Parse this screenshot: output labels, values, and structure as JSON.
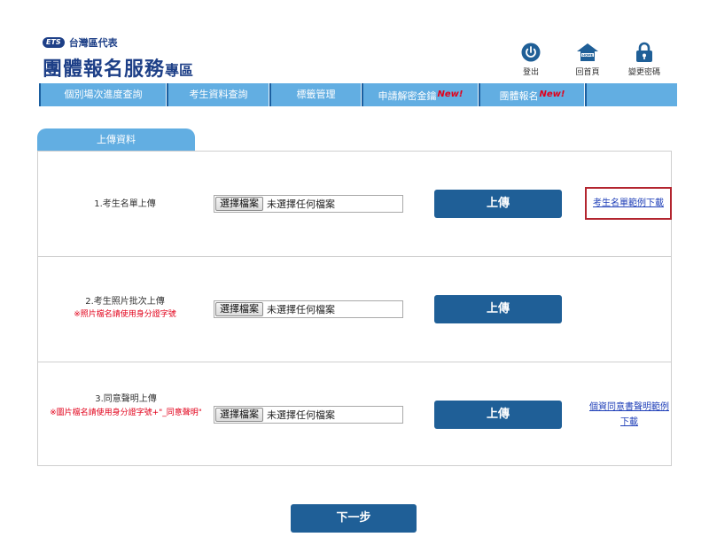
{
  "header": {
    "ets_badge": "ETS",
    "org_name": "台灣區代表",
    "title_main": "團體報名服務",
    "title_sub": "專區",
    "icons": [
      {
        "icon": "power-icon",
        "label": "登出"
      },
      {
        "icon": "home-icon",
        "label": "回首頁",
        "icon_text": "HOME"
      },
      {
        "icon": "lock-icon",
        "label": "變更密碼"
      }
    ]
  },
  "nav": {
    "items": [
      {
        "label": "個別場次進度查詢",
        "new": ""
      },
      {
        "label": "考生資料查詢",
        "new": ""
      },
      {
        "label": "標籤管理",
        "new": ""
      },
      {
        "label": "申請解密金鑰",
        "new": "New!"
      },
      {
        "label": "團體報名",
        "new": "New!"
      }
    ]
  },
  "tab": {
    "label": "上傳資料"
  },
  "rows": [
    {
      "label": "1.考生名單上傳",
      "note": "",
      "file_button": "選擇檔案",
      "file_status": "未選擇任何檔案",
      "upload_label": "上傳",
      "link": "考生名單範例下載"
    },
    {
      "label": "2.考生照片批次上傳",
      "note": "※照片檔名請使用身分證字號",
      "file_button": "選擇檔案",
      "file_status": "未選擇任何檔案",
      "upload_label": "上傳",
      "link": ""
    },
    {
      "label": "3.同意聲明上傳",
      "note": "※圖片檔名請使用身分證字號+\"_同意聲明\"",
      "file_button": "選擇檔案",
      "file_status": "未選擇任何檔案",
      "upload_label": "上傳",
      "link": "個資同意書聲明範例下載"
    }
  ],
  "next_button": "下一步",
  "colors": {
    "nav_bg": "#62aee2",
    "button_bg": "#1f5f97",
    "title_blue": "#1d3f87",
    "new_red": "#e2001a",
    "highlight_border": "#b3252f",
    "link_blue": "#1f3fb8"
  }
}
